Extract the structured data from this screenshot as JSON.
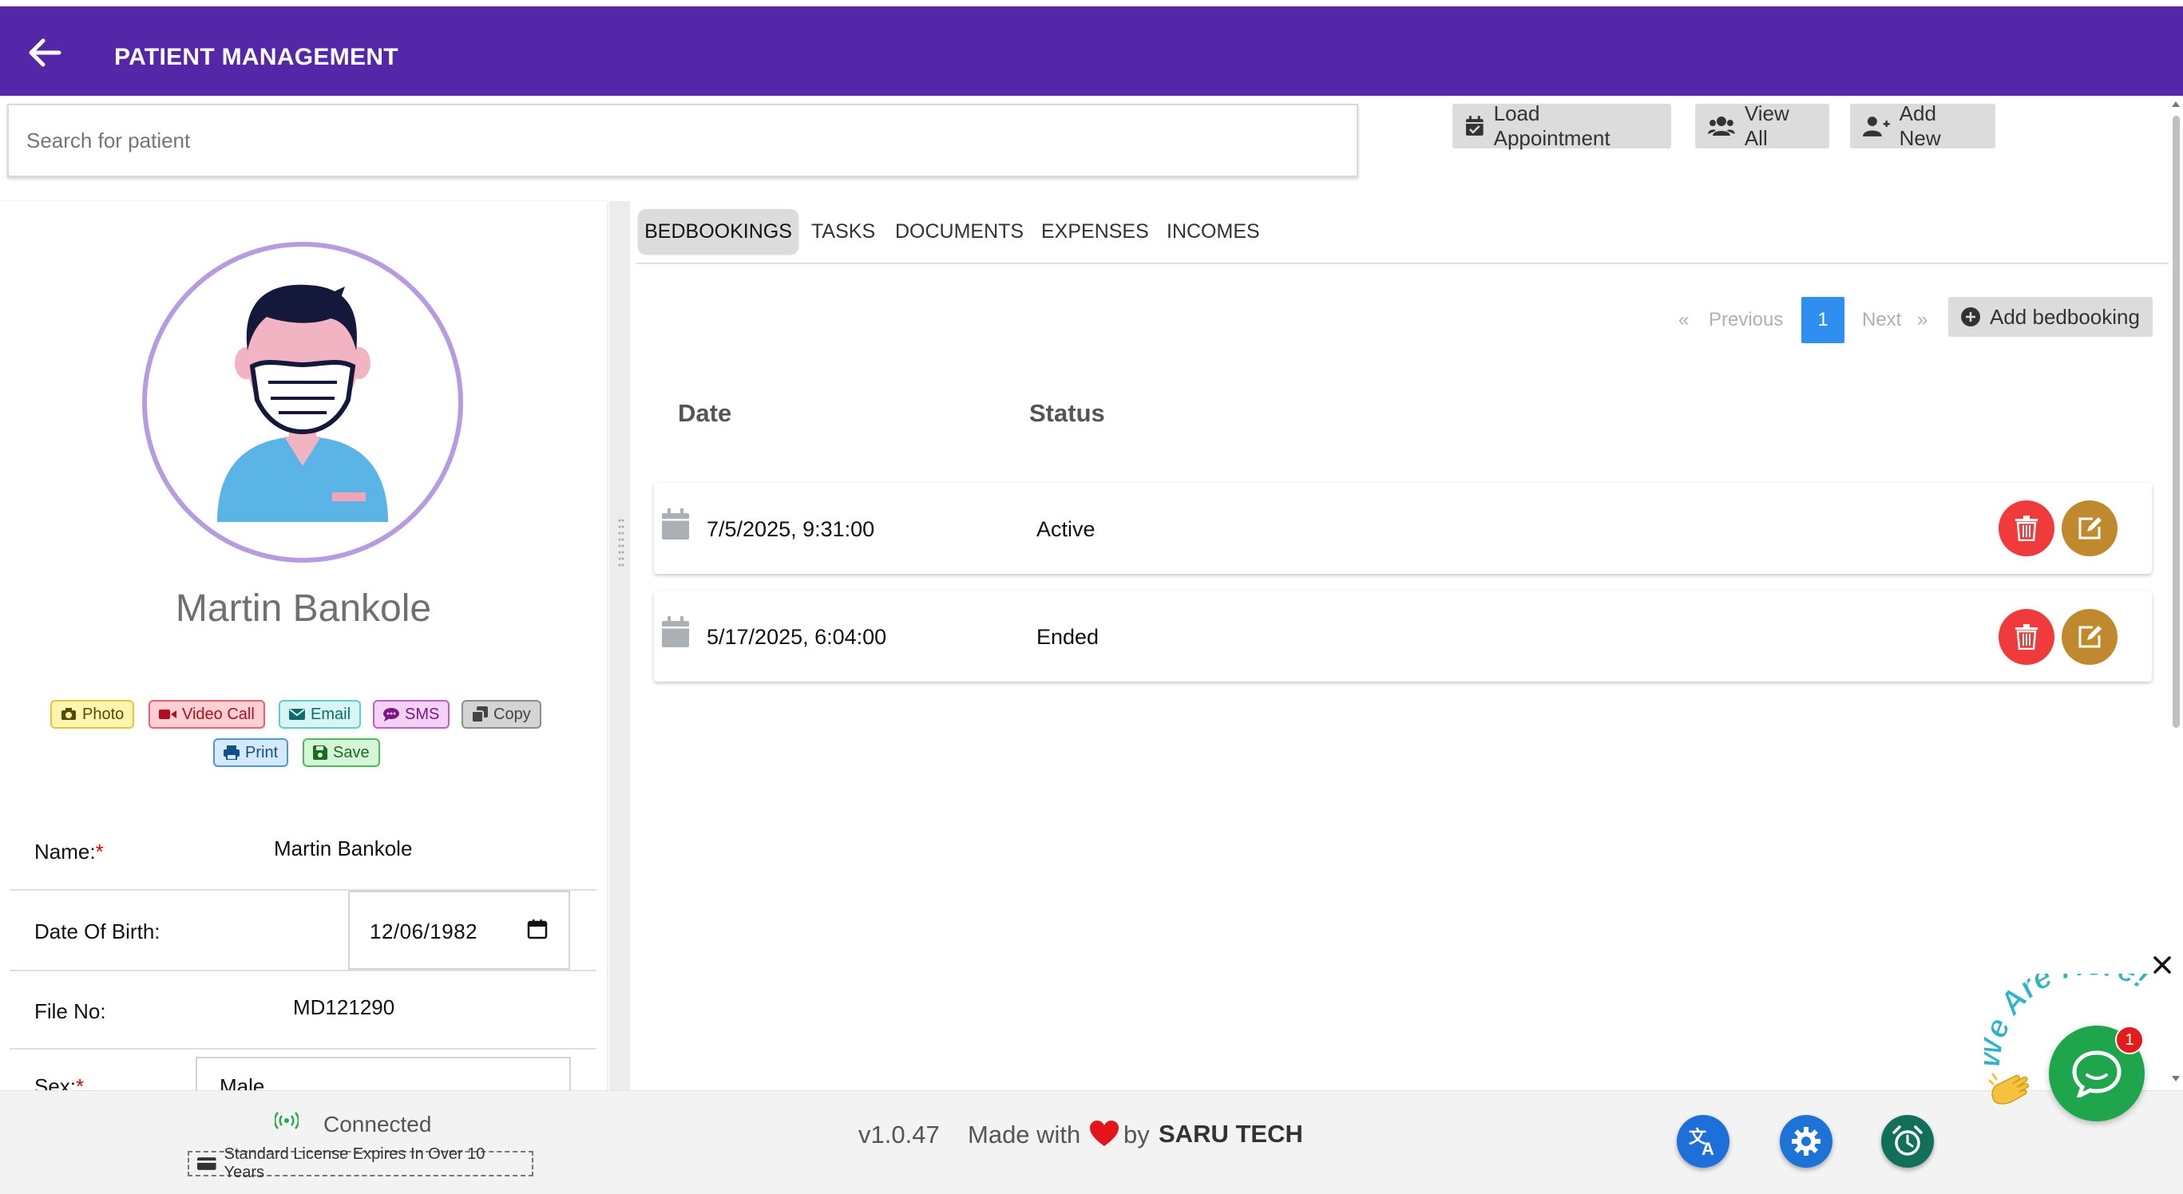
{
  "header": {
    "title": "PATIENT MANAGEMENT",
    "back_icon": "arrow-left-icon",
    "bg_color": "#5327a8"
  },
  "search": {
    "placeholder": "Search for patient",
    "value": ""
  },
  "toolbar": {
    "load_appointment": "Load Appointment",
    "view_all": "View All",
    "add_new": "Add New"
  },
  "patient": {
    "name": "Martin Bankole",
    "actions": [
      {
        "label": "Photo",
        "icon": "camera-icon"
      },
      {
        "label": "Video Call",
        "icon": "video-icon"
      },
      {
        "label": "Email",
        "icon": "envelope-icon"
      },
      {
        "label": "SMS",
        "icon": "chat-icon"
      },
      {
        "label": "Copy",
        "icon": "copy-icon"
      },
      {
        "label": "Print",
        "icon": "printer-icon"
      },
      {
        "label": "Save",
        "icon": "floppy-icon"
      }
    ],
    "fields": {
      "name_label": "Name:",
      "name_value": "Martin Bankole",
      "dob_label": "Date Of Birth:",
      "dob_value": "12/06/1982",
      "file_label": "File No:",
      "file_value": "MD121290",
      "sex_label": "Sex:",
      "sex_value": "Male",
      "required_mark": "*"
    }
  },
  "tabs": [
    {
      "label": "BEDBOOKINGS",
      "active": true
    },
    {
      "label": "TASKS"
    },
    {
      "label": "DOCUMENTS"
    },
    {
      "label": "EXPENSES"
    },
    {
      "label": "INCOMES"
    }
  ],
  "pagination": {
    "prev_arrow": "«",
    "prev": "Previous",
    "current": "1",
    "next": "Next",
    "next_arrow": "»"
  },
  "add_bedbooking": "Add bedbooking",
  "table": {
    "columns": [
      "Date",
      "Status"
    ],
    "rows": [
      {
        "date": "7/5/2025, 9:31:00",
        "status": "Active"
      },
      {
        "date": "5/17/2025, 6:04:00",
        "status": "Ended"
      }
    ]
  },
  "footer": {
    "connection": "Connected",
    "license": "Standard License Expires In Over 10 Years",
    "version": "v1.0.47",
    "made_with": "Made with",
    "by": "by",
    "brand": "SARU TECH"
  },
  "chat": {
    "count": "1",
    "banner": "We Are Here!"
  },
  "colors": {
    "accent": "#5327a8",
    "danger": "#ef3b3b",
    "edit": "#c0892e",
    "primary": "#2e8ff0"
  }
}
